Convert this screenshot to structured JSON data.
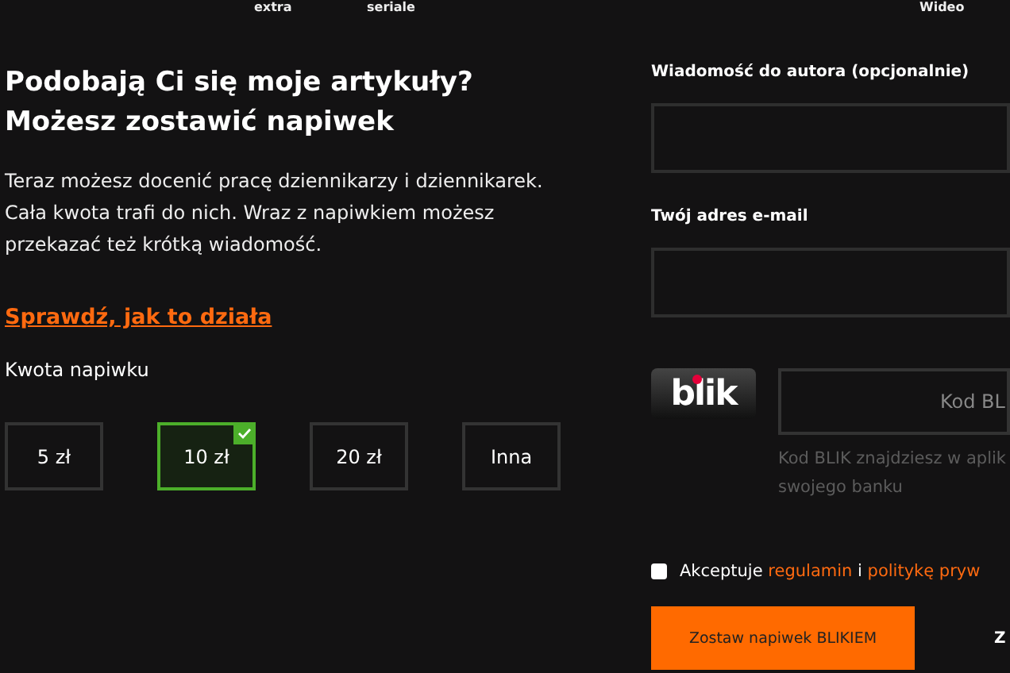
{
  "top_nav": [
    {
      "label": "extra"
    },
    {
      "label": "seriale"
    },
    {
      "label": "Wideo"
    }
  ],
  "heading": [
    "Podobają Ci się moje artykuły?",
    "Możesz zostawić napiwek"
  ],
  "intro": "Teraz możesz docenić pracę dziennikarzy i dziennikarek. Cała kwota trafi do nich. Wraz z napiwkiem możesz przekazać też krótką wiadomość.",
  "how_it_works_link": "Sprawdź, jak to działa",
  "amount_label": "Kwota napiwku",
  "amounts": [
    {
      "label": "5 zł",
      "selected": false
    },
    {
      "label": "10 zł",
      "selected": true
    },
    {
      "label": "20 zł",
      "selected": false
    },
    {
      "label": "Inna",
      "selected": false
    }
  ],
  "message_label": "Wiadomość do autora (opcjonalnie)",
  "email_label": "Twój adres e-mail",
  "blik": {
    "logo": "blik",
    "placeholder": "Kod BL",
    "hint": "Kod BLIK znajdziesz w aplik swojego banku"
  },
  "terms": {
    "checked": false,
    "prefix": "Akceptuje",
    "link_1": "regulamin",
    "joiner": "i",
    "link_2": "politykę pryw"
  },
  "submit_button": "Zostaw napiwek BLIKIEM",
  "secondary_button": "Z"
}
